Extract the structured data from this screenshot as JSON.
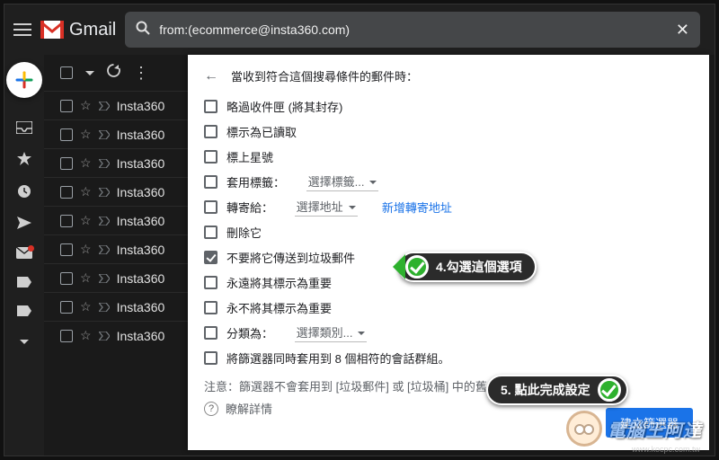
{
  "header": {
    "brand": "Gmail",
    "search_query": "from:(ecommerce@insta360.com)"
  },
  "list": {
    "senders": [
      "Insta360",
      "Insta360",
      "Insta360",
      "Insta360",
      "Insta360",
      "Insta360",
      "Insta360",
      "Insta360",
      "Insta360"
    ]
  },
  "panel": {
    "title": "當收到符合這個搜尋條件的郵件時：",
    "opts": {
      "skip_inbox": "略過收件匣 (將其封存)",
      "mark_read": "標示為已讀取",
      "star": "標上星號",
      "apply_label": "套用標籤：",
      "label_sel": "選擇標籤...",
      "forward": "轉寄給：",
      "forward_sel": "選擇地址",
      "add_forward": "新增轉寄地址",
      "delete": "刪除它",
      "never_spam": "不要將它傳送到垃圾郵件",
      "always_important": "永遠將其標示為重要",
      "never_important": "永不將其標示為重要",
      "categorize": "分類為：",
      "cat_sel": "選擇類別...",
      "also_apply": "將篩選器同時套用到 8 個相符的會話群組。"
    },
    "note": "注意：篩選器不會套用到 [垃圾郵件] 或 [垃圾桶] 中的舊會話群組",
    "learn": "瞭解詳情",
    "create": "建立篩選器"
  },
  "callouts": {
    "c4": "4.勾選這個選項",
    "c5": "5. 點此完成設定"
  },
  "watermark": {
    "title": "電腦王阿達",
    "sub": "www.kocpc.com.tw"
  }
}
